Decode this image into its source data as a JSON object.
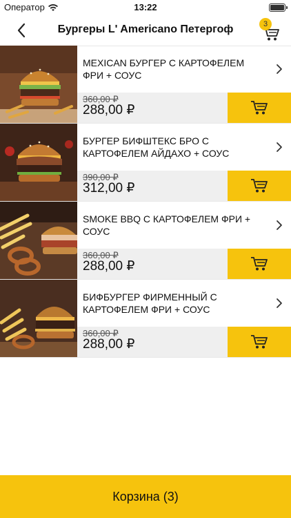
{
  "status_bar": {
    "carrier": "Оператор",
    "time": "13:22"
  },
  "nav": {
    "title": "Бургеры L' Americano Петергоф",
    "cart_count": "3"
  },
  "products": [
    {
      "name": "MEXICAN БУРГЕР С КАРТОФЕЛЕМ ФРИ + СОУС",
      "old_price": "360,00 ₽",
      "price": "288,00 ₽"
    },
    {
      "name": "БУРГЕР БИФШТЕКС БРО С КАРТОФЕЛЕМ АЙДАХО + СОУС",
      "old_price": "390,00 ₽",
      "price": "312,00 ₽"
    },
    {
      "name": "SMOKE BBQ С КАРТОФЕЛЕМ ФРИ + СОУС",
      "old_price": "360,00 ₽",
      "price": "288,00 ₽"
    },
    {
      "name": "БИФБУРГЕР ФИРМЕННЫЙ С КАРТОФЕЛЕМ ФРИ + СОУС",
      "old_price": "360,00 ₽",
      "price": "288,00 ₽"
    }
  ],
  "bottom": {
    "cart_label": "Корзина (3)"
  },
  "colors": {
    "accent": "#f6c30d",
    "price_row_bg": "#efefef"
  }
}
